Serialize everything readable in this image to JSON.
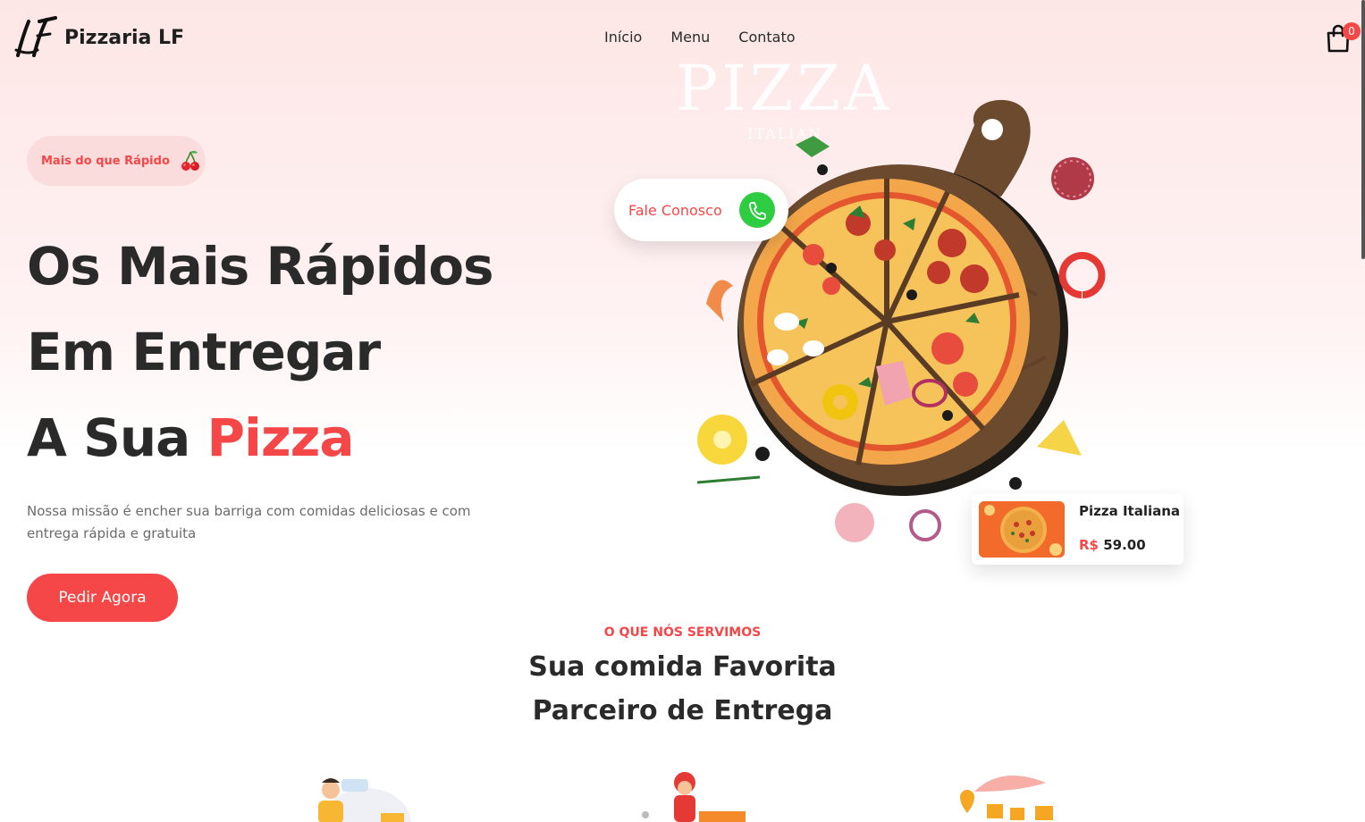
{
  "brand": {
    "name": "Pizzaria LF",
    "logo_initials": "LF"
  },
  "nav": {
    "items": [
      "Início",
      "Menu",
      "Contato"
    ]
  },
  "cart": {
    "count": "0"
  },
  "hero": {
    "badge": "Mais do que Rápido",
    "title_line1": "Os Mais Rápidos",
    "title_line2": "Em Entregar",
    "title_line3_prefix": "A Sua ",
    "title_line3_accent": "Pizza",
    "description": "Nossa missão é encher sua barriga com comidas deliciosas e com entrega rápida e gratuita",
    "cta_label": "Pedir Agora",
    "board_title": "PIZZA",
    "board_subtitle": "ITALIAN"
  },
  "contact": {
    "label": "Fale Conosco"
  },
  "featured": {
    "name": "Pizza Italiana",
    "currency": "R$",
    "price": "59.00"
  },
  "services": {
    "eyebrow": "O QUE NÓS SERVIMOS",
    "title_line1": "Sua comida Favorita",
    "title_line2": "Parceiro de Entrega"
  },
  "colors": {
    "accent": "#f54748",
    "phone": "#2ecc40",
    "text": "#2a2a2a"
  }
}
